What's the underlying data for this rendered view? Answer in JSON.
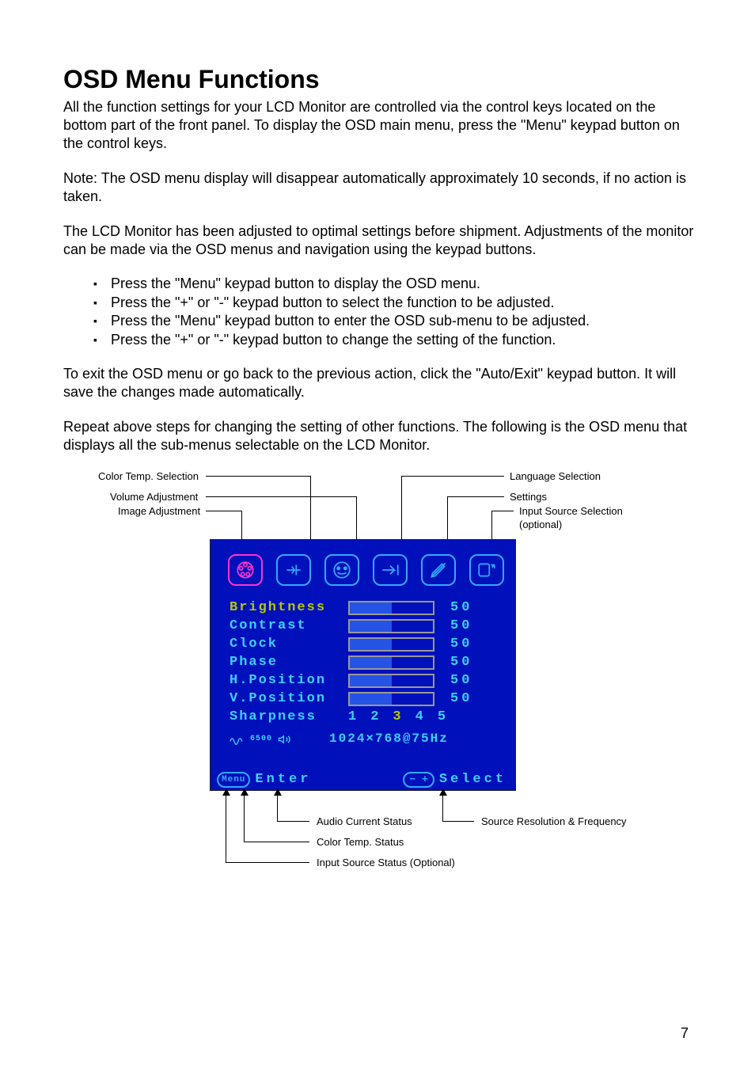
{
  "title": "OSD Menu Functions",
  "para1": "All the function settings for your LCD Monitor are controlled via the control keys located on the bottom part of the front panel.    To display the OSD main menu, press the \"Menu\" keypad button on the control keys.",
  "para2": "Note: The OSD menu display will disappear automatically approximately 10 seconds, if no action is taken.",
  "para3": "The LCD Monitor has been adjusted to optimal settings before shipment. Adjustments of the monitor can be made via the OSD menus and navigation using the keypad buttons.",
  "bullets": [
    "Press the \"Menu\" keypad button to display the OSD menu.",
    "Press the \"+\" or \"-\" keypad button to select the function to be adjusted.",
    "Press the \"Menu\" keypad button to enter the OSD sub-menu to be adjusted.",
    "Press the \"+\" or \"-\" keypad button to change the setting of the function."
  ],
  "para4": "To exit the OSD menu or go back to the previous action, click the \"Auto/Exit\" keypad button. It will save the changes made automatically.",
  "para5": "Repeat above steps for changing the setting of other functions. The following is the OSD menu that displays all the sub-menus selectable on the LCD Monitor.",
  "callouts": {
    "colorTemp": "Color Temp. Selection",
    "volume": "Volume Adjustment",
    "image": "Image Adjustment",
    "language": "Language Selection",
    "settings": "Settings",
    "inputSrc": "Input Source Selection (optional)",
    "audioStatus": "Audio Current Status",
    "colorTempStatus": "Color Temp. Status",
    "inputStatus": "Input Source Status (Optional)",
    "resFreq": "Source Resolution & Frequency"
  },
  "osd": {
    "items": {
      "brightness": "Brightness",
      "contrast": "Contrast",
      "clock": "Clock",
      "phase": "Phase",
      "hpos": "H.Position",
      "vpos": "V.Position",
      "sharp": "Sharpness"
    },
    "val": "50",
    "sharpOpts": [
      "1",
      "2",
      "3",
      "4",
      "5"
    ],
    "status6500": "6500",
    "resolution": "1024×768@75Hz",
    "enter": "Enter",
    "select": "Select",
    "menu": "Menu",
    "pm": "− +"
  },
  "page": "7"
}
